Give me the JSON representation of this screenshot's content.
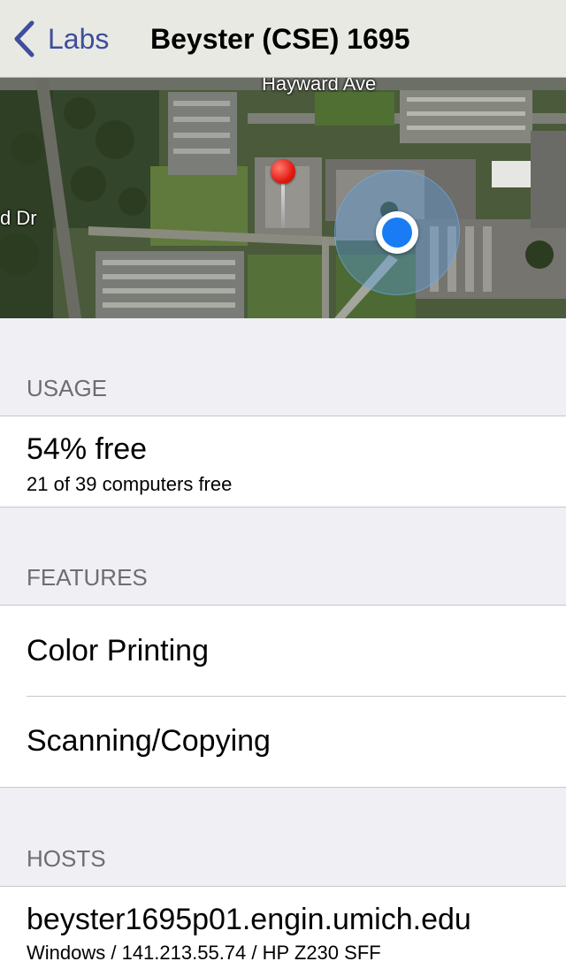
{
  "nav": {
    "back_label": "Labs",
    "title": "Beyster (CSE) 1695"
  },
  "map": {
    "streets": [
      "Hayward Ave",
      "d Dr"
    ]
  },
  "usage": {
    "header": "USAGE",
    "percent_text": "54% free",
    "detail": "21 of 39 computers free",
    "free_fraction": 0.54
  },
  "features": {
    "header": "FEATURES",
    "items": [
      "Color Printing",
      "Scanning/Copying"
    ]
  },
  "hosts": {
    "header": "HOSTS",
    "items": [
      {
        "name": "beyster1695p01.engin.umich.edu",
        "detail": "Windows / 141.213.55.74 / HP Z230 SFF"
      }
    ]
  },
  "colors": {
    "tint": "#3d4e9c",
    "background": "#efeff4",
    "location_dot": "#1a7cf5",
    "pin": "#e31b12"
  }
}
